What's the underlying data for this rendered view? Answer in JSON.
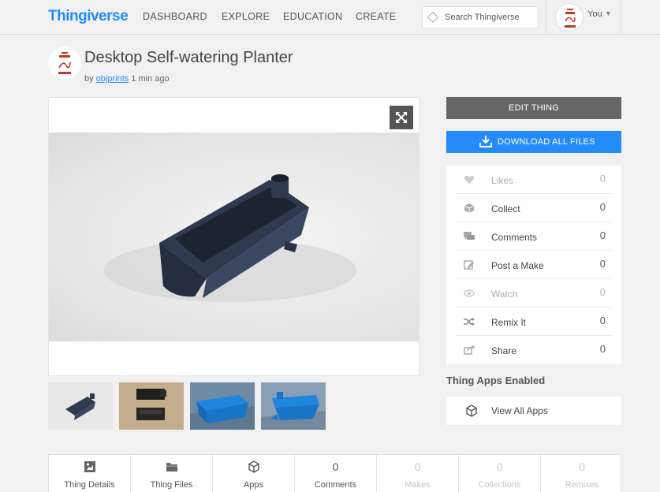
{
  "nav": {
    "logo": "Thingiverse",
    "links": [
      "DASHBOARD",
      "EXPLORE",
      "EDUCATION",
      "CREATE"
    ],
    "search_placeholder": "Search Thingiverse",
    "user_label": "You"
  },
  "thing": {
    "title": "Desktop Self-watering Planter",
    "by_prefix": "by",
    "author": "objprints",
    "time_ago": "1 min ago"
  },
  "sidebar": {
    "edit_label": "EDIT THING",
    "download_label": "DOWNLOAD ALL FILES",
    "stats": [
      {
        "label": "Likes",
        "count": "0",
        "icon": "heart-icon"
      },
      {
        "label": "Collect",
        "count": "0",
        "icon": "collect-icon"
      },
      {
        "label": "Comments",
        "count": "0",
        "icon": "comments-icon"
      },
      {
        "label": "Post a Make",
        "count": "0",
        "icon": "post-make-icon"
      },
      {
        "label": "Watch",
        "count": "0",
        "icon": "eye-icon"
      },
      {
        "label": "Remix It",
        "count": "0",
        "icon": "shuffle-icon"
      },
      {
        "label": "Share",
        "count": "0",
        "icon": "share-icon"
      }
    ],
    "apps_heading": "Thing Apps Enabled",
    "apps_link": "View All Apps"
  },
  "tabs": [
    {
      "label": "Thing Details",
      "icon": "details-icon"
    },
    {
      "label": "Thing Files",
      "icon": "folder-icon"
    },
    {
      "label": "Apps",
      "icon": "cube-icon"
    },
    {
      "label": "Comments",
      "count": "0"
    },
    {
      "label": "Makes",
      "count": "0"
    },
    {
      "label": "Collections",
      "count": "0"
    },
    {
      "label": "Remixes",
      "count": "0"
    }
  ],
  "colors": {
    "brand_blue": "#248bfb",
    "edit_gray": "#666666",
    "page_bg": "#f1f1f1"
  }
}
